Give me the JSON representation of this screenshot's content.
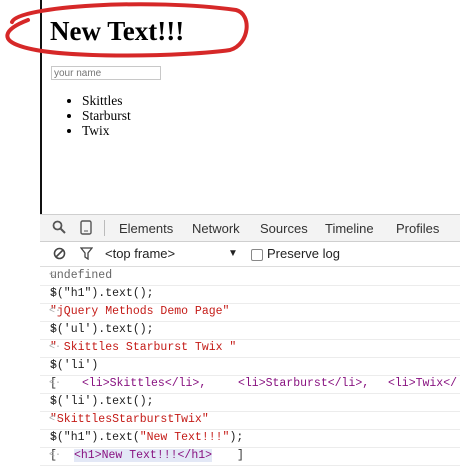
{
  "page": {
    "heading": "New Text!!!",
    "name_placeholder": "your name",
    "list_items": [
      "Skittles",
      "Starburst",
      "Twix"
    ]
  },
  "devtools": {
    "tabs": [
      "Elements",
      "Network",
      "Sources",
      "Timeline",
      "Profiles"
    ],
    "frame_select": "<top frame>",
    "preserve_log": "Preserve log"
  },
  "console": {
    "undefined": "undefined",
    "cmd1": "$(\"h1\").text();",
    "out1": "\"jQuery Methods Demo Page\"",
    "cmd2": "$('ul').text();",
    "out2": "\" Skittles Starburst Twix \"",
    "cmd3": "$('li')",
    "out3_open": "[",
    "out3_items": [
      "<li>Skittles</li>,",
      "<li>Starburst</li>,",
      "<li>Twix</"
    ],
    "cmd4": "$('li').text();",
    "out4": "\"SkittlesStarburstTwix\"",
    "cmd5_prefix": "$(\"h1\").text(",
    "cmd5_arg": "\"New Text!!!\"",
    "cmd5_suffix": ");",
    "out5_open": "[",
    "out5_item": "<h1>New Text!!!</h1>",
    "out5_close": "]"
  },
  "colors": {
    "annotation": "#d62828",
    "string": "#c41a16",
    "tag": "#881280"
  }
}
